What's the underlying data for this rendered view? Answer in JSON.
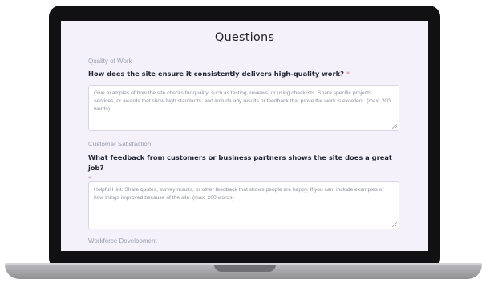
{
  "form": {
    "title": "Questions",
    "questions": [
      {
        "section": "Quality of Work",
        "question": "How does the site ensure it consistently delivers high-quality work?",
        "required_mark": "*",
        "placeholder": "Give examples of how the site checks for quality, such as testing, reviews, or using checklists. Share specific projects, services, or awards that show high standards, and include any results or feedback that prove the work is excellent. (max: 200 words)"
      },
      {
        "section": "Customer Satisfaction",
        "question": "What feedback from customers or business partners shows the site does a great job?",
        "required_mark": "*",
        "placeholder": "Helpful Hint: Share quotes, survey results, or other feedback that shows people are happy. If you can, include examples of how things improved because of the site. (max: 200 words)"
      },
      {
        "section": "Workforce Development"
      }
    ]
  }
}
